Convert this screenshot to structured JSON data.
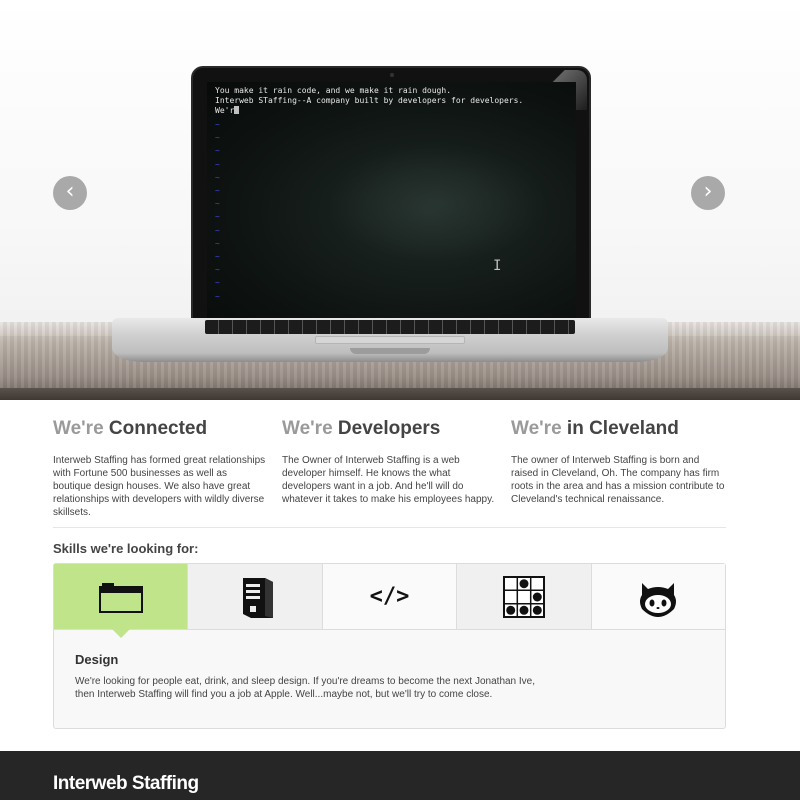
{
  "hero": {
    "terminal_lines": [
      "You make it rain code, and we make it rain dough.",
      "Interweb STaffing--A company built by developers for developers.",
      "We'r"
    ],
    "tilde": "~",
    "tilde_count": 14,
    "ibeam": "I",
    "prev_arrow": "‹",
    "next_arrow": "›"
  },
  "features": [
    {
      "prefix": "We're",
      "title": "Connected",
      "text": "Interweb Staffing has formed great relationships with Fortune 500 businesses as well as boutique design houses. We also have great relationships with developers with wildly diverse skillsets."
    },
    {
      "prefix": "We're",
      "title": "Developers",
      "text": "The Owner of Interweb Staffing is a web developer himself. He knows the what developers want in a job. And he'll will do whatever it takes to make his employees happy."
    },
    {
      "prefix": "We're",
      "title": "in Cleveland",
      "text": "The owner of Interweb Staffing is born and raised in Cleveland, Oh. The company has firm roots in the area and has a mission contribute to Cleveland's technical renaissance."
    }
  ],
  "skills": {
    "heading": "Skills we're looking for:",
    "tabs": [
      {
        "icon": "browser-window-icon",
        "active": true
      },
      {
        "icon": "server-tower-icon",
        "active": false
      },
      {
        "icon": "code-tag-icon",
        "label": "</>",
        "active": false
      },
      {
        "icon": "glider-grid-icon",
        "active": false
      },
      {
        "icon": "github-octocat-icon",
        "active": false
      }
    ],
    "selected_title": "Design",
    "selected_text": "We're looking for people eat, drink, and sleep design. If you're dreams to become the next Jonathan Ive, then Interweb Staffing will find you a job at Apple. Well...maybe not, but we'll try to come close."
  },
  "footer": {
    "brand": "Interweb Staffing"
  },
  "colors": {
    "accent_green": "#c0e48a",
    "footer_bg": "#262626",
    "arrow_bg": "#a9a9a9"
  }
}
